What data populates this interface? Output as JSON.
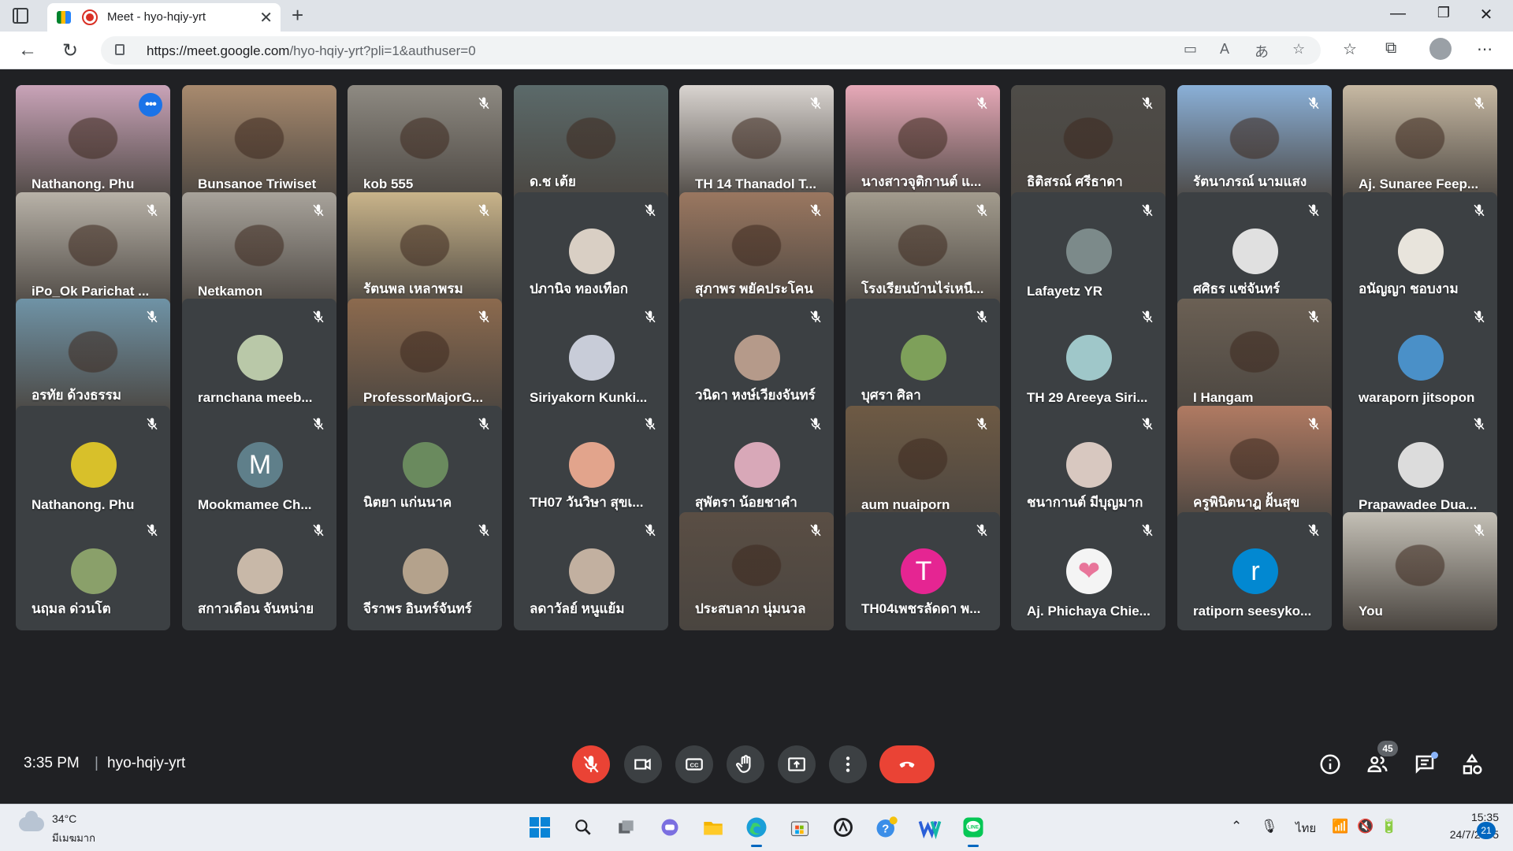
{
  "browser": {
    "tab_title": "Meet - hyo-hqiy-yrt",
    "url_host": "https://meet.google.com",
    "url_path": "/hyo-hqiy-yrt?pli=1&authuser=0"
  },
  "participants": [
    {
      "name": "Nathanong. Phu",
      "type": "video",
      "bg": "#c9a3b8",
      "muted": false,
      "active": true
    },
    {
      "name": "Bunsanoe Triwiset",
      "type": "video",
      "bg": "#a88a6e",
      "muted": false
    },
    {
      "name": "kob 555",
      "type": "video",
      "bg": "#8e8a82",
      "muted": true
    },
    {
      "name": "ด.ช เต้ย",
      "type": "video",
      "bg": "#5b6a6a",
      "muted": false
    },
    {
      "name": "TH 14 Thanadol T...",
      "type": "video",
      "bg": "#d9d4d0",
      "muted": true
    },
    {
      "name": "นางสาวจุติกานต์ แ...",
      "type": "video",
      "bg": "#e7a9b8",
      "muted": true
    },
    {
      "name": "ธิติสรณ์ ศรีธาดา",
      "type": "video",
      "bg": "#4e4c48",
      "muted": true
    },
    {
      "name": "รัตนาภรณ์ นามแสง",
      "type": "video",
      "bg": "#8ab0d8",
      "muted": true
    },
    {
      "name": "Aj. Sunaree Feep...",
      "type": "video",
      "bg": "#c7b9a3",
      "muted": true
    },
    {
      "name": "iPo_Ok Parichat ...",
      "type": "video",
      "bg": "#b8b2a8",
      "muted": true
    },
    {
      "name": "Netkamon",
      "type": "video",
      "bg": "#a8a39b",
      "muted": true
    },
    {
      "name": "รัตนพล เหลาพรม",
      "type": "video",
      "bg": "#c9b48a",
      "muted": true
    },
    {
      "name": "ปภานิจ ทองเทือก",
      "type": "avatar",
      "bg": "#d9cfc4",
      "muted": true
    },
    {
      "name": "สุภาพร พยัคประโคน",
      "type": "video",
      "bg": "#9a7760",
      "muted": true
    },
    {
      "name": "โรงเรียนบ้านไร่เหนื...",
      "type": "video",
      "bg": "#a39c8e",
      "muted": true
    },
    {
      "name": "Lafayetz YR",
      "type": "avatar",
      "bg": "#7c8a8a",
      "muted": true
    },
    {
      "name": "ศศิธร แซ่จันทร์",
      "type": "avatar",
      "bg": "#e0e0e0",
      "muted": true
    },
    {
      "name": "อนัญญา ชอบงาม",
      "type": "avatar",
      "bg": "#e8e4dc",
      "muted": true
    },
    {
      "name": "อรทัย ด้วงธรรม",
      "type": "video",
      "bg": "#6f93a6",
      "muted": true
    },
    {
      "name": "rarnchana meeb...",
      "type": "avatar",
      "bg": "#b9c8a8",
      "muted": true
    },
    {
      "name": "ProfessorMajorG...",
      "type": "video",
      "bg": "#8c6a4e",
      "muted": true
    },
    {
      "name": "Siriyakorn Kunki...",
      "type": "avatar",
      "bg": "#c8ccd8",
      "muted": true
    },
    {
      "name": "วนิดา หงษ์เวียงจันทร์",
      "type": "avatar",
      "bg": "#b59a8a",
      "muted": true
    },
    {
      "name": "บุศรา ศิลา",
      "type": "avatar",
      "bg": "#7ea05a",
      "muted": true
    },
    {
      "name": "TH 29 Areeya Siri...",
      "type": "avatar",
      "bg": "#9fc7c9",
      "muted": true
    },
    {
      "name": "I Hangam",
      "type": "video",
      "bg": "#6b6054",
      "muted": true
    },
    {
      "name": "waraporn jitsopon",
      "type": "avatar",
      "bg": "#4a90c8",
      "muted": true
    },
    {
      "name": "Nathanong. Phu",
      "type": "avatar",
      "bg": "#d8c02a",
      "muted": true
    },
    {
      "name": "Mookmamee Ch...",
      "type": "letter",
      "letter": "M",
      "bg": "#5f7f8a",
      "muted": true
    },
    {
      "name": "นิตยา แก่นนาค",
      "type": "avatar",
      "bg": "#6a8a5e",
      "muted": true
    },
    {
      "name": "TH07 วันวิษา สุขเ...",
      "type": "avatar",
      "bg": "#e2a48c",
      "muted": true
    },
    {
      "name": "สุพัตรา น้อยชาคำ",
      "type": "avatar",
      "bg": "#d8a8b8",
      "muted": true
    },
    {
      "name": "aum nuaiporn",
      "type": "video",
      "bg": "#6e5a44",
      "muted": true
    },
    {
      "name": "ชนากานต์ มีบุญมาก",
      "type": "avatar",
      "bg": "#d8c8c0",
      "muted": true
    },
    {
      "name": "ครูพินิตนาฎ ฝั้นสุข",
      "type": "video",
      "bg": "#b07a62",
      "muted": true
    },
    {
      "name": "Prapawadee Dua...",
      "type": "avatar",
      "bg": "#dcdcdc",
      "muted": true
    },
    {
      "name": "นฤมล ด่วนโต",
      "type": "avatar",
      "bg": "#8aa06a",
      "muted": true
    },
    {
      "name": "สกาวเดือน จันหน่าย",
      "type": "avatar",
      "bg": "#c8b8a8",
      "muted": true
    },
    {
      "name": "จีราพร อินทร์จันทร์",
      "type": "avatar",
      "bg": "#b4a28c",
      "muted": true
    },
    {
      "name": "ลดาวัลย์ หนูแย้ม",
      "type": "avatar",
      "bg": "#c2b0a0",
      "muted": true
    },
    {
      "name": "ประสบลาภ นุ่มนวล",
      "type": "video",
      "bg": "#5a4e44",
      "muted": true
    },
    {
      "name": "TH04เพชรลัดดา พ...",
      "type": "letter",
      "letter": "T",
      "bg": "#e52592",
      "muted": true
    },
    {
      "name": "Aj. Phichaya Chie...",
      "type": "letter",
      "letter": "❤",
      "bg": "#f4f4f4",
      "fg": "#e8759a",
      "muted": true
    },
    {
      "name": "ratiporn seesyko...",
      "type": "letter",
      "letter": "r",
      "bg": "#0288d1",
      "muted": true
    },
    {
      "name": "You",
      "type": "video",
      "bg": "#c4c0b6",
      "muted": true
    }
  ],
  "meet_bar": {
    "time": "3:35 PM",
    "separator": "|",
    "meeting_code": "hyo-hqiy-yrt",
    "participant_count": "45"
  },
  "taskbar": {
    "temperature": "34°C",
    "weather": "มีเมฆมาก",
    "language": "ไทย",
    "time": "15:35",
    "date": "24/7/2565",
    "notifications": "21"
  },
  "colors": {
    "accent_blue": "#8ab4f8",
    "danger_red": "#ea4335",
    "tile_bg": "#3c4043",
    "page_bg": "#202124"
  }
}
